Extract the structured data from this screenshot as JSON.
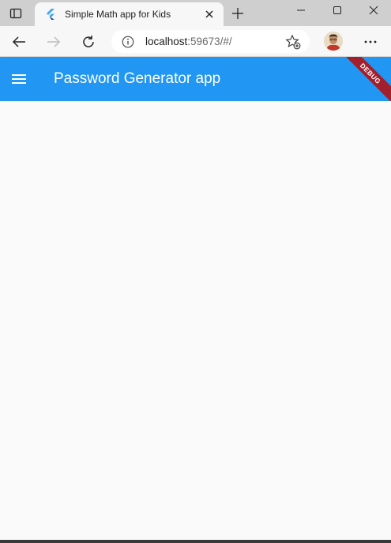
{
  "browser": {
    "tab": {
      "title": "Simple Math app for Kids",
      "favicon": "flutter-logo-icon"
    },
    "address_bar": {
      "url_host": "localhost",
      "url_rest": ":59673/#/"
    },
    "icons": {
      "tab_actions": "tab-actions-icon",
      "close_tab": "close-icon",
      "new_tab": "plus-icon",
      "minimize": "minimize-icon",
      "maximize": "maximize-icon",
      "close_window": "close-icon",
      "back": "arrow-left-icon",
      "forward": "arrow-right-icon",
      "refresh": "refresh-icon",
      "site_info": "info-icon",
      "favorites": "star-add-icon",
      "profile": "avatar",
      "menu": "more-horizontal-icon"
    }
  },
  "app": {
    "appbar_title": "Password Generator app",
    "debug_banner": "DEBUG",
    "menu_icon": "hamburger-menu-icon",
    "colors": {
      "primary": "#2196f3",
      "background": "#fafafa",
      "debug_banner": "#a2202d"
    }
  }
}
